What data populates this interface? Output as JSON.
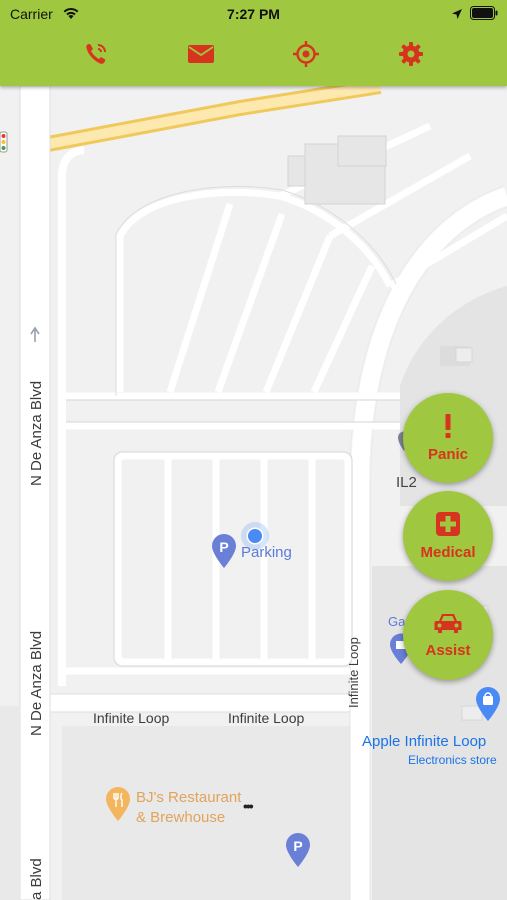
{
  "status_bar": {
    "carrier": "Carrier",
    "time": "7:27 PM",
    "icons": [
      "wifi-icon",
      "location-arrow-icon",
      "battery-icon"
    ]
  },
  "toolbar": {
    "accent_color": "#9fc73f",
    "icon_color": "#d6341e",
    "buttons": [
      "phone-icon",
      "mail-icon",
      "crosshair-icon",
      "gear-icon"
    ]
  },
  "map": {
    "streets": {
      "n_de_anza_upper": "N De Anza Blvd",
      "n_de_anza_lower": "N De Anza Blvd",
      "n_de_anza_bottom": "a Blvd",
      "infinite_loop_left": "Infinite Loop",
      "infinite_loop_right": "Infinite Loop",
      "infinite_loop_vertical": "Infinite Loop"
    },
    "pois": {
      "parking": "Parking",
      "il2": "IL2",
      "ga": "Ga",
      "apple_store": "Apple Infinite Loop",
      "apple_store_sub": "Electronics store",
      "bjs_line1": "BJ's Restaurant",
      "bjs_line2": "& Brewhouse",
      "more": "•••"
    }
  },
  "actions": [
    {
      "label": "Panic",
      "icon": "exclamation-icon"
    },
    {
      "label": "Medical",
      "icon": "medical-cross-icon"
    },
    {
      "label": "Assist",
      "icon": "car-icon"
    }
  ]
}
